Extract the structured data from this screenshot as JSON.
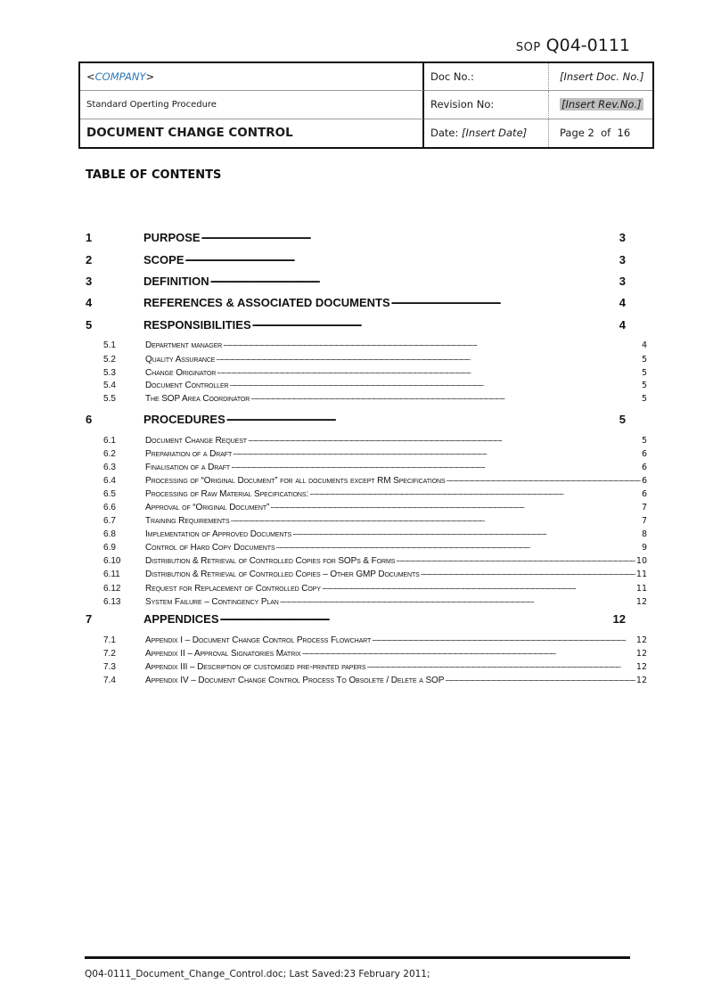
{
  "sop_code": {
    "label": "SOP",
    "number": "Q04-0111"
  },
  "header_table": {
    "company_open": "<",
    "company_name": "COMPANY",
    "company_close": ">",
    "doc_type": "Standard Operting Procedure",
    "doc_title": "DOCUMENT CHANGE CONTROL",
    "doc_no_label": "Doc No.:",
    "doc_no_value": "[Insert Doc. No.]",
    "revision_label": "Revision No:",
    "revision_value": "[Insert Rev.No.]",
    "date_label": "Date:",
    "date_value": "[Insert Date]",
    "page_label": "Page 2  of  16"
  },
  "toc": {
    "heading": "TABLE OF CONTENTS",
    "entries": [
      {
        "level": 1,
        "num": "1",
        "title": "PURPOSE",
        "page": "3"
      },
      {
        "level": 1,
        "num": "2",
        "title": "SCOPE",
        "page": "3"
      },
      {
        "level": 1,
        "num": "3",
        "title": "DEFINITION",
        "page": "3"
      },
      {
        "level": 1,
        "num": "4",
        "title": "REFERENCES & ASSOCIATED DOCUMENTS",
        "page": "4"
      },
      {
        "level": 1,
        "num": "5",
        "title": "RESPONSIBILITIES",
        "page": "4"
      },
      {
        "level": 2,
        "num": "5.1",
        "title": "Department manager",
        "page": "4"
      },
      {
        "level": 2,
        "num": "5.2",
        "title": "Quality Assurance",
        "page": "5"
      },
      {
        "level": 2,
        "num": "5.3",
        "title": "Change Originator",
        "page": "5"
      },
      {
        "level": 2,
        "num": "5.4",
        "title": "Document Controller",
        "page": "5"
      },
      {
        "level": 2,
        "num": "5.5",
        "title": "The SOP Area Coordinator",
        "page": "5"
      },
      {
        "level": 1,
        "num": "6",
        "title": "PROCEDURES",
        "page": "5"
      },
      {
        "level": 2,
        "num": "6.1",
        "title": "Document Change Request",
        "page": "5"
      },
      {
        "level": 2,
        "num": "6.2",
        "title": "Preparation of a Draft",
        "page": "6"
      },
      {
        "level": 2,
        "num": "6.3",
        "title": "Finalisation of a Draft",
        "page": "6"
      },
      {
        "level": 2,
        "num": "6.4",
        "title": "Processing of “Original Document” for all documents except RM Specifications",
        "page": "6"
      },
      {
        "level": 2,
        "num": "6.5",
        "title": "Processing of Raw Material Specifications:",
        "page": "6"
      },
      {
        "level": 2,
        "num": "6.6",
        "title": "Approval of “Original Document”",
        "page": "7"
      },
      {
        "level": 2,
        "num": "6.7",
        "title": "Training Requirements",
        "page": "7"
      },
      {
        "level": 2,
        "num": "6.8",
        "title": "Implementation of Approved Documents",
        "page": "8"
      },
      {
        "level": 2,
        "num": "6.9",
        "title": "Control of Hard Copy Documents",
        "page": "9"
      },
      {
        "level": 2,
        "num": "6.10",
        "title": "Distribution & Retrieval of Controlled Copies for SOPs & Forms",
        "page": "10"
      },
      {
        "level": 2,
        "num": "6.11",
        "title": "Distribution & Retrieval of Controlled Copies – Other GMP Documents",
        "page": "11"
      },
      {
        "level": 2,
        "num": "6.12",
        "title": "Request for Replacement of Controlled Copy",
        "page": "11"
      },
      {
        "level": 2,
        "num": "6.13",
        "title": "System Failure – Contingency Plan",
        "page": "12"
      },
      {
        "level": 1,
        "num": "7",
        "title": "APPENDICES",
        "page": "12"
      },
      {
        "level": 2,
        "num": "7.1",
        "title": "Appendix I – Document Change Control Process Flowchart",
        "page": "12"
      },
      {
        "level": 2,
        "num": "7.2",
        "title": "Appendix II – Approval Signatories Matrix",
        "page": "12"
      },
      {
        "level": 2,
        "num": "7.3",
        "title": "Appendix III – Description of customised pre-printed papers",
        "page": "12"
      },
      {
        "level": 2,
        "num": "7.4",
        "title": "Appendix IV – Document Change Control Process To Obsolete / Delete a SOP",
        "page": "12"
      }
    ]
  },
  "footer": {
    "text": "Q04-0111_Document_Change_Control.doc;  Last Saved:23 February 2011;"
  },
  "colors": {
    "company_accent": "#2e75b6",
    "highlight": "#bfbfbf"
  }
}
